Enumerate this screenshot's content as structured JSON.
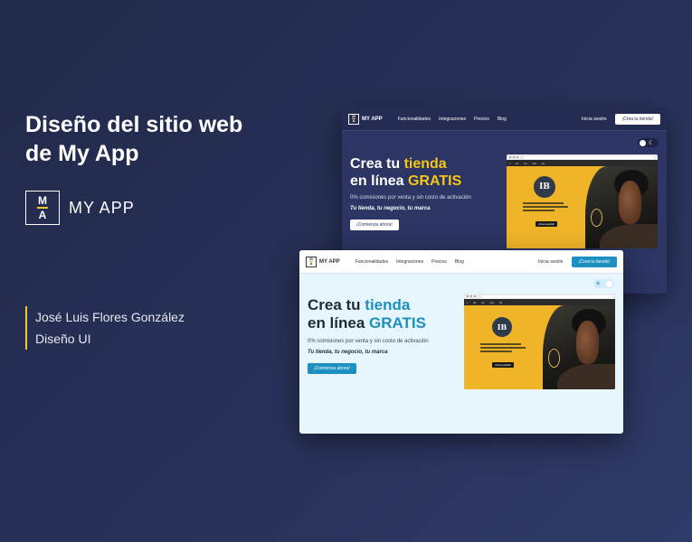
{
  "left": {
    "title_line1": "Diseño del sitio web",
    "title_line2": "de My App",
    "logo_top": "M",
    "logo_bottom": "A",
    "brand": "MY APP",
    "author": "José Luis Flores González",
    "role": "Diseño UI"
  },
  "mockup": {
    "brand": "MY APP",
    "logo_top": "M",
    "logo_bottom": "A",
    "nav_links": [
      "Funcionalidades",
      "Integraciones",
      "Precios",
      "Blog"
    ],
    "login": "Inicia sesión",
    "cta": "¡Crea tu tienda!",
    "hero_line1_a": "Crea tu ",
    "hero_line1_b": "tienda",
    "hero_line2_a": "en línea ",
    "hero_line2_b": "GRATIS",
    "subtitle": "0% comisiones por venta y sin costo de activación",
    "tagline": "Tu tienda, tu negocio, tu marca",
    "hero_button": "¡Comienza ahora!",
    "store_logo": "IB",
    "store_button": "¡Crea pedido!"
  },
  "colors": {
    "background": "#283158",
    "accent_yellow": "#f5c518",
    "accent_blue": "#1d8fc0",
    "dark_mock_bg": "#2c3563",
    "light_mock_bg": "#e6f6fc"
  },
  "icons": {
    "theme_dark": "moon-icon",
    "theme_light": "sun-icon"
  }
}
